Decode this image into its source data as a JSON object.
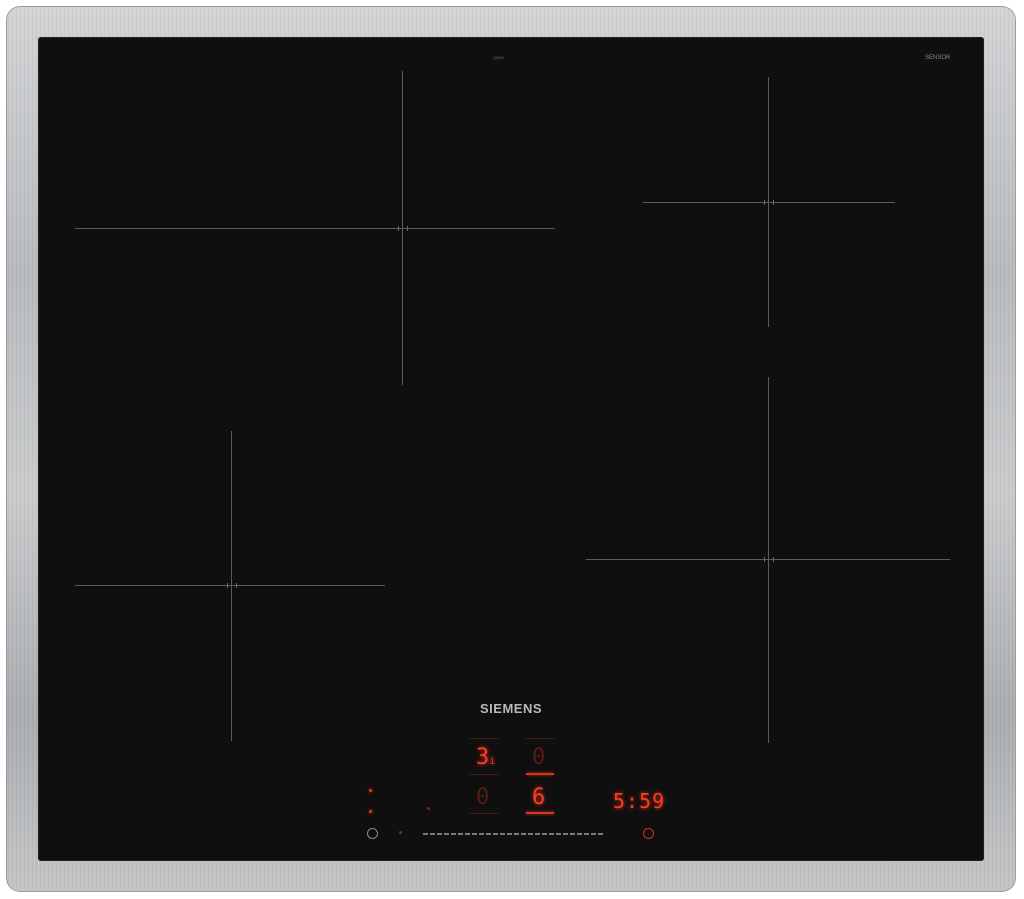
{
  "hob": {
    "brand": "SIEMENS",
    "top_label": "iQ300",
    "sensor_logo": "SENSOR"
  },
  "displays": {
    "front_left": "3",
    "front_left_sub": "i",
    "rear_right": "0",
    "front_right_zone": "0",
    "rear_left_level": "6",
    "timer": "5:59"
  },
  "colors": {
    "glass": "#0f0f10",
    "frame": "#c0c2c4",
    "led": "#ff3b1e"
  },
  "icons": {
    "power": "power-icon",
    "timer": "timer-icon"
  }
}
